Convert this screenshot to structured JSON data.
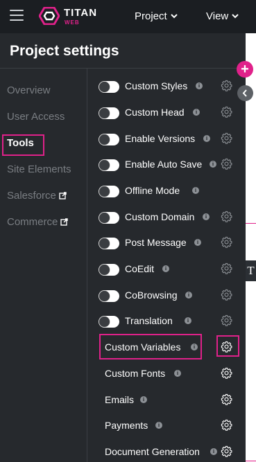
{
  "header": {
    "brand": "TITAN",
    "brand_sub": "WEB",
    "menus": [
      "Project",
      "View"
    ]
  },
  "panel": {
    "title": "Project settings",
    "nav": [
      {
        "label": "Overview",
        "active": false,
        "external": false
      },
      {
        "label": "User Access",
        "active": false,
        "external": false
      },
      {
        "label": "Tools",
        "active": true,
        "external": false
      },
      {
        "label": "Site Elements",
        "active": false,
        "external": false
      },
      {
        "label": "Salesforce",
        "active": false,
        "external": true
      },
      {
        "label": "Commerce",
        "active": false,
        "external": true
      }
    ],
    "toggle_rows": [
      {
        "label": "Custom Styles",
        "on": false,
        "gear": "dim"
      },
      {
        "label": "Custom Head",
        "on": false,
        "gear": "dim"
      },
      {
        "label": "Enable Versions",
        "on": false,
        "gear": "dim"
      },
      {
        "label": "Enable Auto Save",
        "on": false,
        "gear": "dim"
      },
      {
        "label": "Offline Mode",
        "on": false,
        "gear": "none"
      },
      {
        "label": "Custom Domain",
        "on": false,
        "gear": "dim"
      },
      {
        "label": "Post Message",
        "on": false,
        "gear": "dim"
      },
      {
        "label": "CoEdit",
        "on": false,
        "gear": "dim"
      },
      {
        "label": "CoBrowsing",
        "on": false,
        "gear": "dim"
      },
      {
        "label": "Translation",
        "on": false,
        "gear": "dim"
      }
    ],
    "config_rows": [
      {
        "label": "Custom Variables",
        "gear": "bright",
        "highlighted": true
      },
      {
        "label": "Custom Fonts",
        "gear": "bright",
        "highlighted": false
      },
      {
        "label": "Emails",
        "gear": "bright",
        "highlighted": false
      },
      {
        "label": "Payments",
        "gear": "bright",
        "highlighted": false
      },
      {
        "label": "Document Generation",
        "gear": "bright",
        "highlighted": false
      }
    ]
  },
  "canvas": {
    "add_button": "+",
    "text_tool": "T"
  },
  "colors": {
    "accent": "#e0218a",
    "panel_bg": "#26292d",
    "topbar_bg": "#1b1e22",
    "nav_inactive": "#7a7e83",
    "gear_dim": "#8c9095",
    "gear_bright": "#ffffff"
  }
}
